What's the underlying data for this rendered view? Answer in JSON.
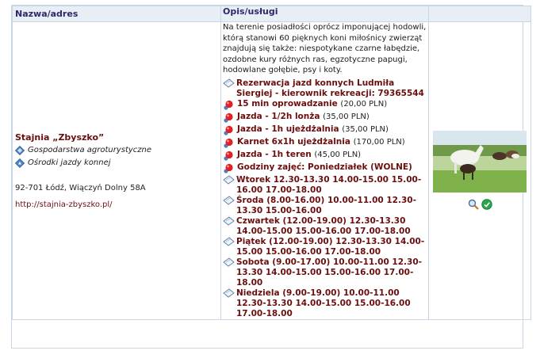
{
  "table": {
    "headers": [
      "Nazwa/adres",
      "Opis/usługi",
      ""
    ]
  },
  "listing": {
    "name": "Stajnia „Zbyszko”",
    "categories": [
      "Gospodarstwa agroturystyczne",
      "Ośrodki jazdy konnej"
    ],
    "address": "92-701 Łódź, Wiączyń Dolny 58A",
    "url": "http://stajnia-zbyszko.pl/",
    "description": "Na terenie posiadłości oprócz imponującej hodowli, którą stanowi 60 pięknych koni miłośnicy zwierząt znajdują się także: niespotykane czarne łabędzie, ozdobne kury różnych ras, egzotyczne papugi, hodowlane gołębie, psy i koty.",
    "items": [
      {
        "type": "note",
        "text": "Rezerwacja jazd konnych Ludmiła Siergiej - kierownik rekreacji: 79365544",
        "price": ""
      },
      {
        "type": "price",
        "text": "15 min oprowadzanie",
        "price": "(20,00 PLN)"
      },
      {
        "type": "price",
        "text": "Jazda - 1/2h lonża",
        "price": "(35,00 PLN)"
      },
      {
        "type": "price",
        "text": "Jazda - 1h ujeżdżalnia",
        "price": "(35,00 PLN)"
      },
      {
        "type": "price",
        "text": "Karnet 6x1h ujeżdżalnia",
        "price": "(170,00 PLN)"
      },
      {
        "type": "price",
        "text": "Jazda - 1h teren",
        "price": "(45,00 PLN)"
      },
      {
        "type": "price",
        "text": "Godziny zajęć: Poniedziałek (WOLNE)",
        "price": ""
      },
      {
        "type": "note",
        "text": "Wtorek 12.30-13.30 14.00-15.00 15.00-16.00 17.00-18.00",
        "price": ""
      },
      {
        "type": "note",
        "text": "Środa (8.00-16.00) 10.00-11.00 12.30-13.30 15.00-16.00",
        "price": ""
      },
      {
        "type": "note",
        "text": "Czwartek (12.00-19.00) 12.30-13.30 14.00-15.00 15.00-16.00 17.00-18.00",
        "price": ""
      },
      {
        "type": "note",
        "text": "Piątek (12.00-19.00) 12.30-13.30 14.00-15.00 15.00-16.00 17.00-18.00",
        "price": ""
      },
      {
        "type": "note",
        "text": "Sobota (9.00-17.00) 10.00-11.00 12.30-13.30 14.00-15.00 15.00-16.00 17.00-18.00",
        "price": ""
      },
      {
        "type": "note",
        "text": "Niedziela (9.00-19.00) 10.00-11.00 12.30-13.30 14.00-15.00 15.00-16.00 17.00-18.00",
        "price": ""
      }
    ]
  },
  "icons": {
    "category": "agrotourism-diamond-icon",
    "note": "note-paper-icon",
    "price": "red-dot-icon",
    "zoom": "magnifier-icon",
    "go": "green-go-icon"
  },
  "colors": {
    "accent": "#6b0e0e",
    "header_bg": "#e8eef6",
    "border": "#c9d6e4"
  }
}
